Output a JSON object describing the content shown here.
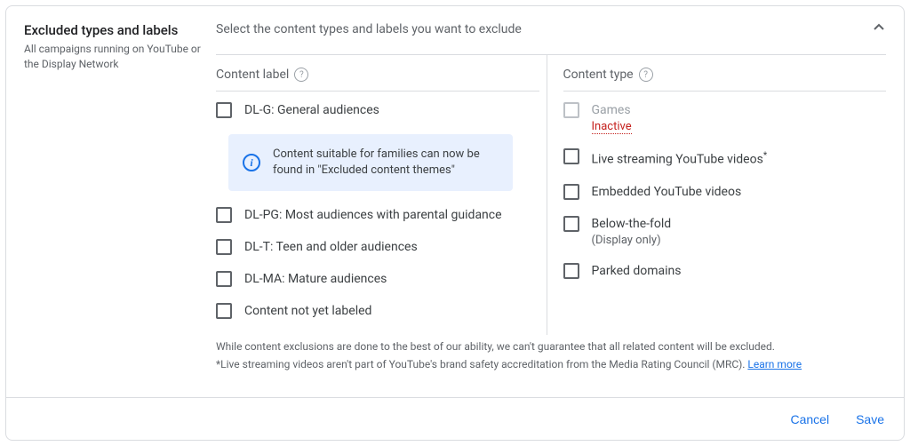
{
  "header": {
    "title": "Excluded types and labels",
    "subtitle": "All campaigns running on YouTube or the Display Network"
  },
  "instruction": "Select the content types and labels you want to exclude",
  "content_label": {
    "header": "Content label",
    "items": [
      {
        "label": "DL-G: General audiences"
      },
      {
        "label": "DL-PG: Most audiences with parental guidance"
      },
      {
        "label": "DL-T: Teen and older audiences"
      },
      {
        "label": "DL-MA: Mature audiences"
      },
      {
        "label": "Content not yet labeled"
      }
    ]
  },
  "info_banner": "Content suitable for families can now be found in \"Excluded content themes\"",
  "content_type": {
    "header": "Content type",
    "items": [
      {
        "label": "Games",
        "status": "Inactive",
        "disabled": true
      },
      {
        "label": "Live streaming YouTube videos",
        "asterisk": true
      },
      {
        "label": "Embedded YouTube videos"
      },
      {
        "label": "Below-the-fold",
        "sublabel": "(Display only)"
      },
      {
        "label": "Parked domains"
      }
    ]
  },
  "disclaimer": {
    "line1": "While content exclusions are done to the best of our ability, we can't guarantee that all related content will be excluded.",
    "line2_prefix": "*",
    "line2": "Live streaming videos aren't part of YouTube's brand safety accreditation from the Media Rating Council (MRC). ",
    "learn_more": "Learn more"
  },
  "footer": {
    "cancel": "Cancel",
    "save": "Save"
  }
}
